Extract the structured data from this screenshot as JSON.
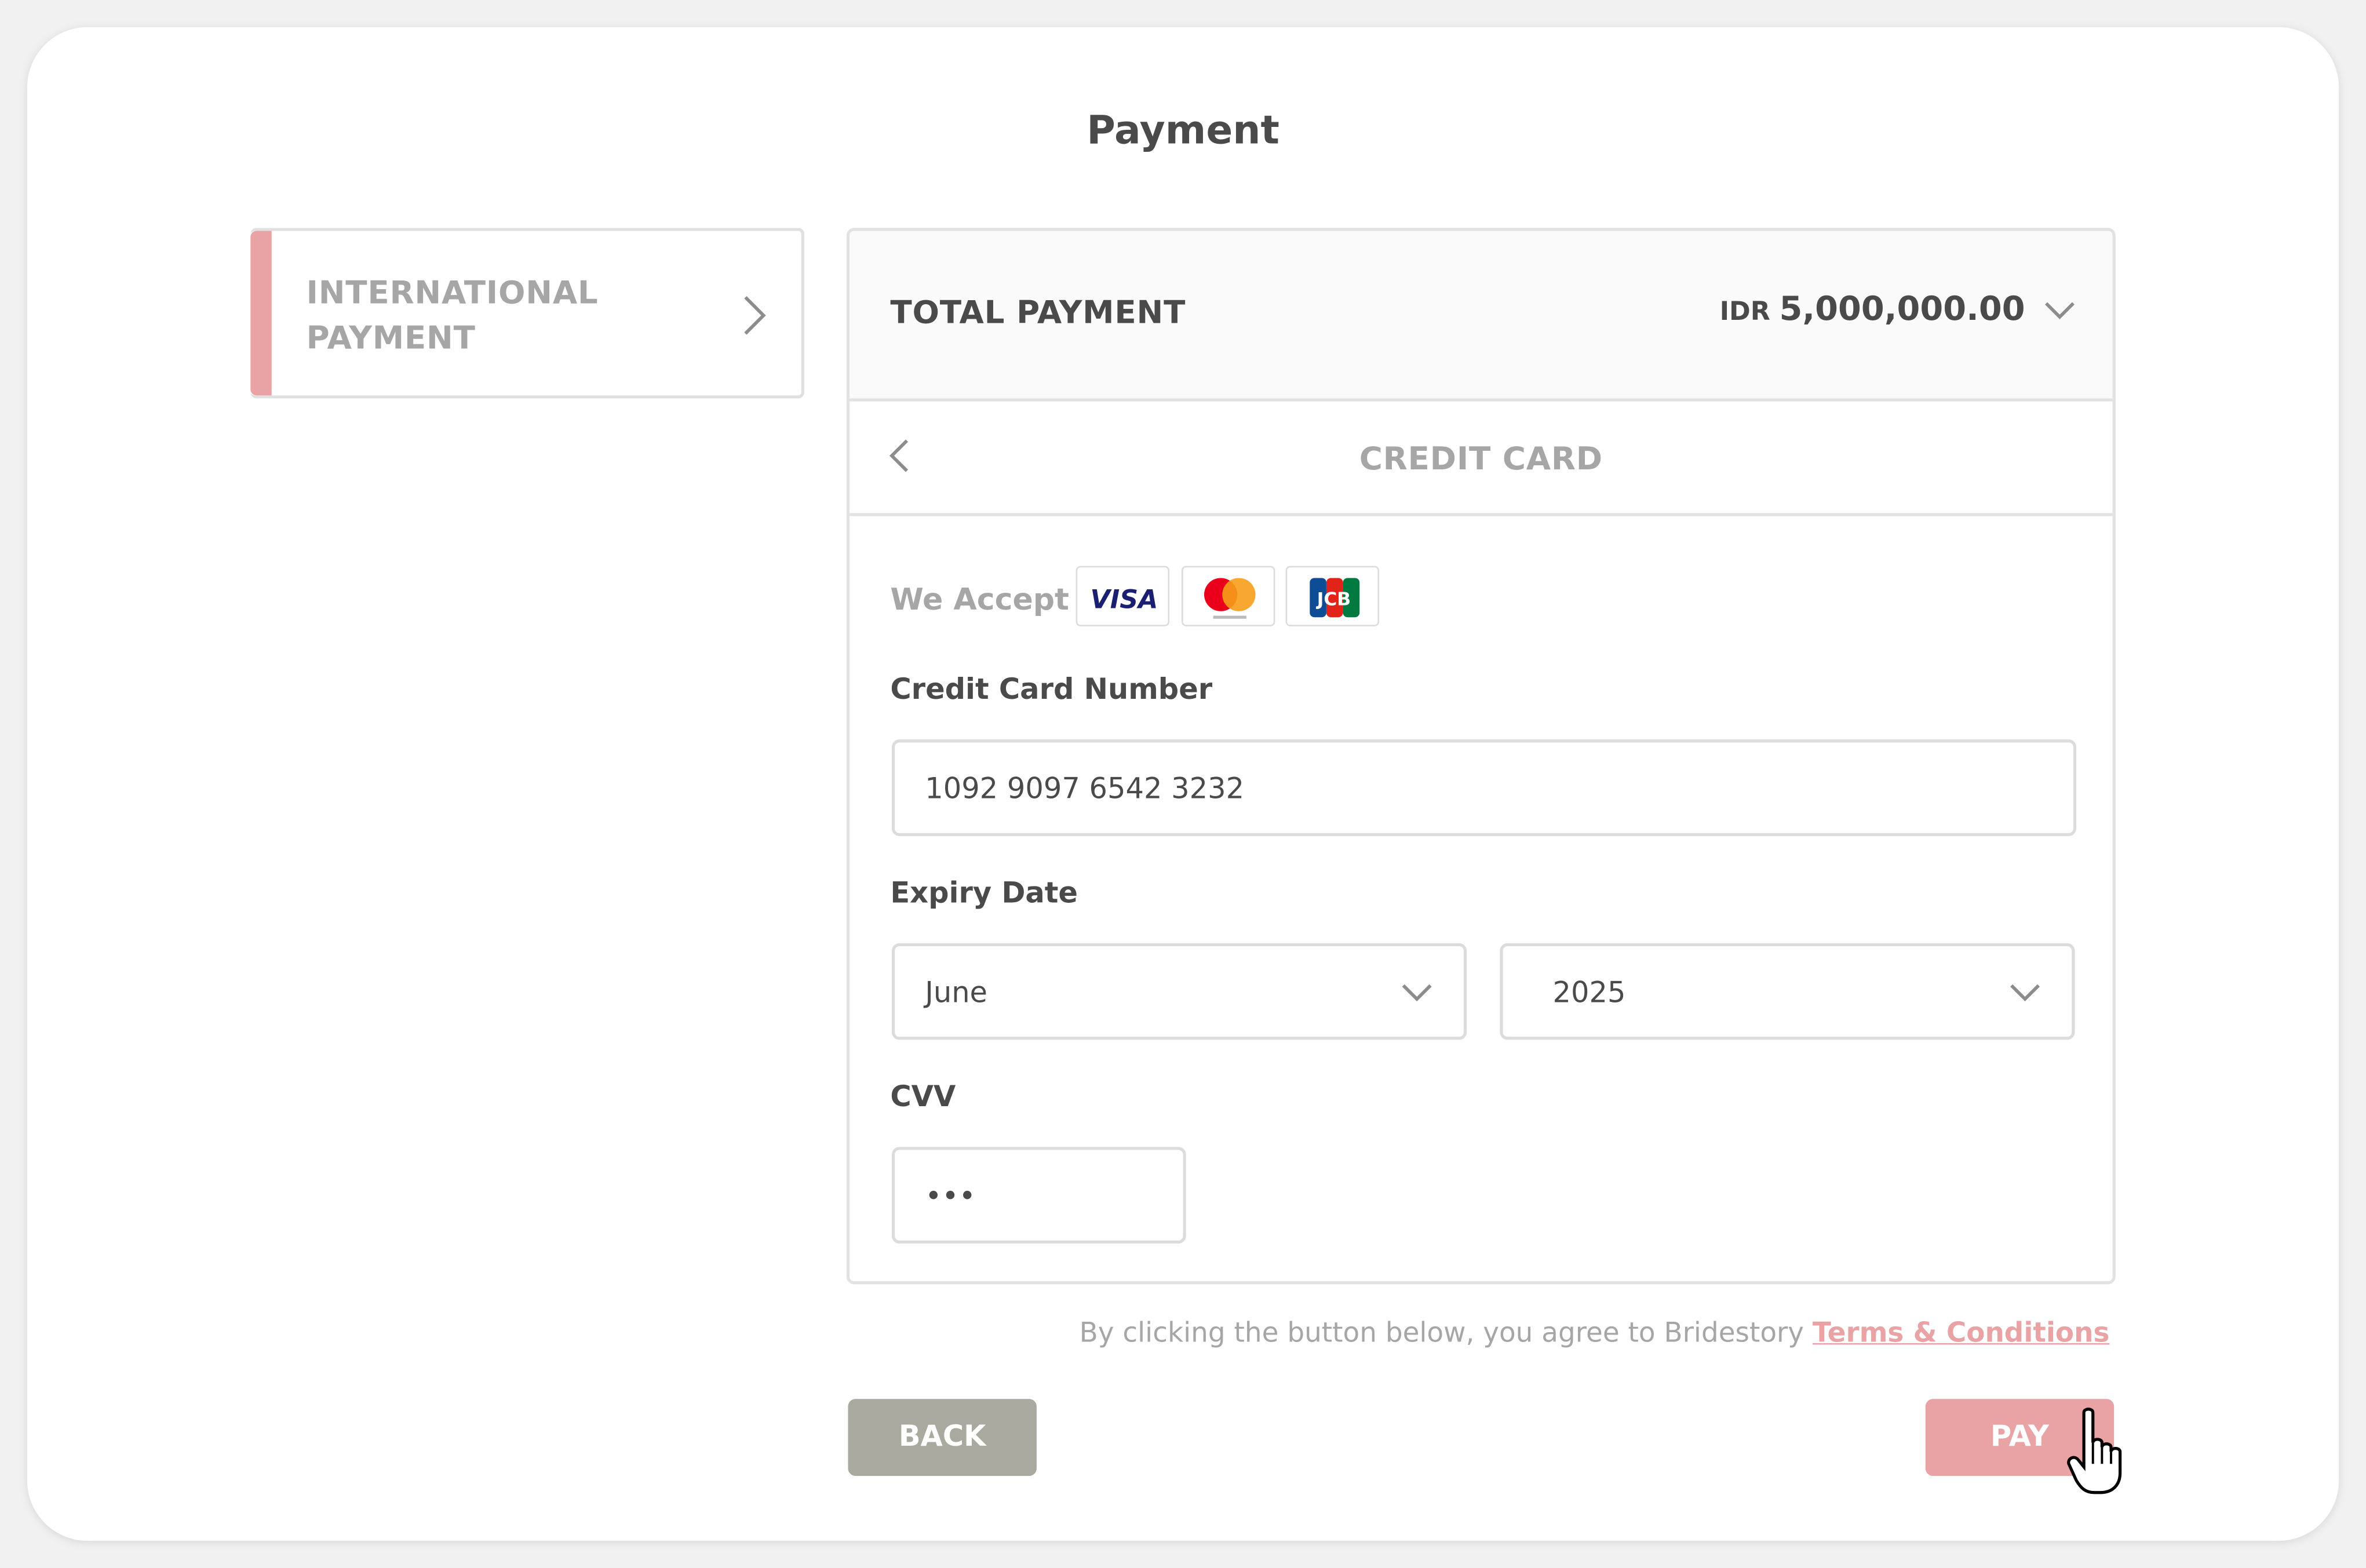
{
  "page": {
    "title": "Payment"
  },
  "sidebar": {
    "method": {
      "label": "INTERNATIONAL PAYMENT",
      "accent_color": "#e9a3a5",
      "icon": "chevron-right-icon"
    }
  },
  "summary": {
    "label": "TOTAL PAYMENT",
    "currency": "IDR",
    "amount": "5,000,000.00",
    "toggle_icon": "chevron-down-icon"
  },
  "credit_card": {
    "title": "CREDIT CARD",
    "back_icon": "chevron-left-icon",
    "accept_label": "We Accept",
    "card_brands": [
      "VISA",
      "Mastercard",
      "JCB"
    ],
    "number": {
      "label": "Credit Card Number",
      "value": "1092 9097 6542 3232"
    },
    "expiry": {
      "label": "Expiry Date",
      "month": "June",
      "year": "2025"
    },
    "cvv": {
      "label": "CVV",
      "value": "•••"
    }
  },
  "terms": {
    "text": "By clicking the button below, you agree to Bridestory ",
    "link": "Terms & Conditions"
  },
  "actions": {
    "back_label": "BACK",
    "pay_label": "PAY"
  },
  "colors": {
    "accent": "#e9a3a5",
    "back_button": "#a9a9a0",
    "text_dark": "#4a4a4a",
    "text_muted": "#a6a6a6"
  }
}
